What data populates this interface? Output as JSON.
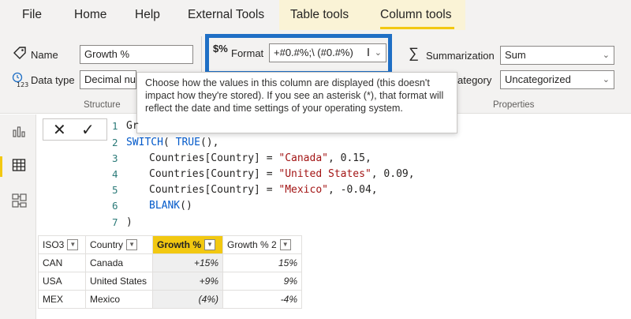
{
  "tabs": [
    {
      "label": "File"
    },
    {
      "label": "Home"
    },
    {
      "label": "Help"
    },
    {
      "label": "External Tools"
    },
    {
      "label": "Table tools"
    },
    {
      "label": "Column tools"
    }
  ],
  "structure": {
    "name_label": "Name",
    "name_value": "Growth %",
    "datatype_label": "Data type",
    "datatype_value": "Decimal nu",
    "group_label": "Structure"
  },
  "formatting": {
    "format_label": "Format",
    "format_value": "+#0.#%;\\ (#0.#%)",
    "format_icon": "$%"
  },
  "properties": {
    "summarization_label": "Summarization",
    "summarization_value": "Sum",
    "category_label": "ategory",
    "category_value": "Uncategorized",
    "group_label": "Properties"
  },
  "tooltip": {
    "text": "Choose how the values in this column are displayed (this doesn't impact how they're stored). If you see an asterisk (*), that format will reflect the date and time settings of your operating system."
  },
  "formula": {
    "line_numbers": [
      "1",
      "2",
      "3",
      "4",
      "5",
      "6",
      "7"
    ],
    "line1": "Gr",
    "line2_kw": "SWITCH",
    "line2_rest": "( ",
    "line2_kw2": "TRUE",
    "line2_end": "(),",
    "line3_ref": "Countries[Country] = ",
    "line3_str": "\"Canada\"",
    "line3_num": ", 0.15,",
    "line4_ref": "Countries[Country] = ",
    "line4_str": "\"United States\"",
    "line4_num": ", 0.09,",
    "line5_ref": "Countries[Country] = ",
    "line5_str": "\"Mexico\"",
    "line5_num": ", -0.04,",
    "line6_kw": "BLANK",
    "line6_end": "()",
    "line7": ")"
  },
  "table": {
    "headers": [
      "ISO3",
      "Country",
      "Growth %",
      "Growth % 2"
    ],
    "rows": [
      [
        "CAN",
        "Canada",
        "+15%",
        "15%"
      ],
      [
        "USA",
        "United States",
        "+9%",
        "9%"
      ],
      [
        "MEX",
        "Mexico",
        "(4%)",
        "-4%"
      ]
    ]
  },
  "colors": {
    "accent": "#f2c811",
    "highlight_box": "#1f6fc5"
  }
}
